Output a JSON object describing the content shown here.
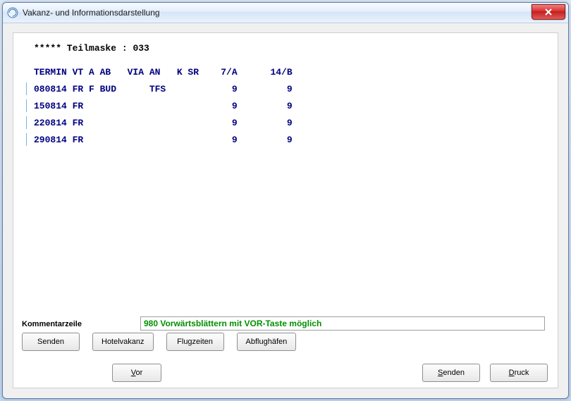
{
  "window": {
    "title": "Vakanz- und Informationsdarstellung"
  },
  "mask": {
    "prefix": "***** Teilmaske :",
    "id": "033"
  },
  "table": {
    "headers": {
      "termin": "TERMIN",
      "vt": "VT",
      "a": "A",
      "ab": "AB",
      "via": "VIA",
      "an": "AN",
      "k": "K",
      "sr": "SR",
      "c7a": "7/A",
      "c14b": "14/B"
    },
    "rows": [
      {
        "termin": "080814",
        "vt": "FR",
        "a": "F",
        "ab": "BUD",
        "via": "",
        "an": "TFS",
        "k": "",
        "sr": "",
        "c7a": "9",
        "c14b": "9"
      },
      {
        "termin": "150814",
        "vt": "FR",
        "a": "",
        "ab": "",
        "via": "",
        "an": "",
        "k": "",
        "sr": "",
        "c7a": "9",
        "c14b": "9"
      },
      {
        "termin": "220814",
        "vt": "FR",
        "a": "",
        "ab": "",
        "via": "",
        "an": "",
        "k": "",
        "sr": "",
        "c7a": "9",
        "c14b": "9"
      },
      {
        "termin": "290814",
        "vt": "FR",
        "a": "",
        "ab": "",
        "via": "",
        "an": "",
        "k": "",
        "sr": "",
        "c7a": "9",
        "c14b": "9"
      }
    ]
  },
  "kommentar": {
    "label": "Kommentarzeile",
    "value": "980 Vorwärtsblättern mit VOR-Taste möglich"
  },
  "buttons": {
    "senden": "Senden",
    "hotelvakanz": "Hotelvakanz",
    "flugzeiten": "Flugzeiten",
    "abflughaefen": "Abflughäfen",
    "vor": "Vor",
    "senden2": "Senden",
    "druck": "Druck",
    "druck_ul": "D",
    "druck_rest": "ruck",
    "vor_ul": "V",
    "vor_rest": "or",
    "senden2_ul": "S",
    "senden2_rest": "enden"
  }
}
